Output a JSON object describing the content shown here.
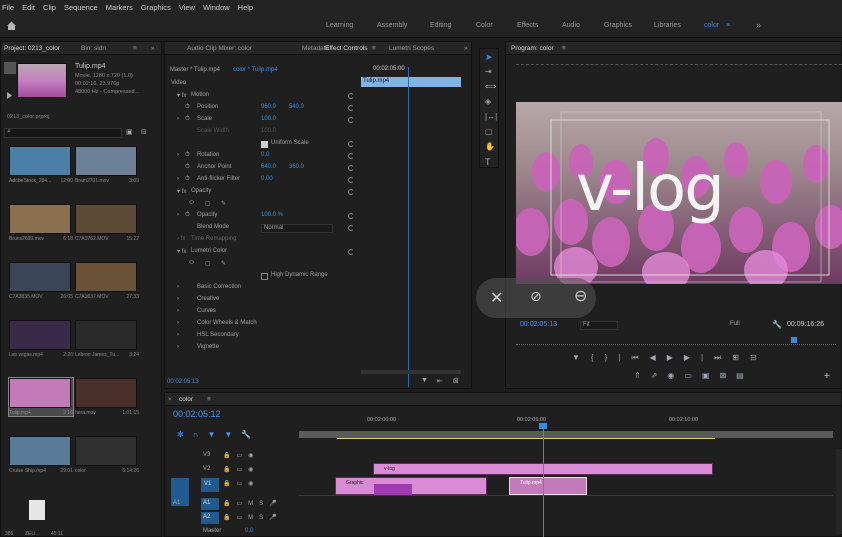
{
  "menu": [
    "File",
    "Edit",
    "Clip",
    "Sequence",
    "Markers",
    "Graphics",
    "View",
    "Window",
    "Help"
  ],
  "workspaces": [
    "Learning",
    "Assembly",
    "Editing",
    "Color",
    "Effects",
    "Audio",
    "Graphics",
    "Libraries",
    "color"
  ],
  "workspace_more": "»",
  "project": {
    "tabs": [
      "Project: 0213_color",
      "Bin: sidn"
    ],
    "preview_name": "Tulip.mp4",
    "preview_line1": "Movie, 1280 x 720 (1.0)",
    "preview_line2": "00:02:16, 23.976p",
    "preview_line3": "48000 Hz - Compressed...",
    "project_file": "0213_color.prproj",
    "items": [
      {
        "name": "AdobeStock_284...",
        "dur": "12:00",
        "color": "#4a7fa8"
      },
      {
        "name": "Bram2701.mov",
        "dur": "3:09",
        "color": "#6b7f96"
      },
      {
        "name": "Bruns2699.mov",
        "dur": "6:18",
        "color": "#8a7050"
      },
      {
        "name": "C7A3762.MOV",
        "dur": "15:22",
        "color": "#5c4a35"
      },
      {
        "name": "C7A3835.MOV",
        "dur": "26:05",
        "color": "#3a4658"
      },
      {
        "name": "C7A3637.MOV",
        "dur": "27:33",
        "color": "#6a5238"
      },
      {
        "name": "Las vegas.mp4",
        "dur": "2:20",
        "color": "#3a2a4a"
      },
      {
        "name": "Lebron James_Tu...",
        "dur": "3:24",
        "color": "#2a2a2a"
      },
      {
        "name": "Tulip.mp4",
        "dur": "2:16",
        "color": "#c27ab8"
      },
      {
        "name": "hera.mov",
        "dur": "1:01:15",
        "color": "#4a3028"
      },
      {
        "name": "Cruise Ship.mp4",
        "dur": "29:01",
        "color": "#5a7a98"
      },
      {
        "name": "color",
        "dur": "5:14:26",
        "color": "#303030"
      }
    ],
    "bottom_left": "386",
    "bottom_file": "ZELI...",
    "bottom_dur": "45:11"
  },
  "effects": {
    "tabs": [
      "Audio Clip Mixer: color",
      "Metadata",
      "Effect Controls",
      "Lumetri Scopes"
    ],
    "master": "Master * Tulip.mp4",
    "sequence": "color * Tulip.mp4",
    "timecode": "00:02:05:00",
    "clip_label": "Tulip.mp4",
    "section_video": "Video",
    "motion": "Motion",
    "position_label": "Position",
    "position_x": "960.0",
    "position_y": "540.0",
    "scale_label": "Scale",
    "scale_val": "100.0",
    "scale_width_label": "Scale Width",
    "scale_width_val": "100.0",
    "uniform": "Uniform Scale",
    "rotation_label": "Rotation",
    "rotation_val": "0.0",
    "anchor_label": "Anchor Point",
    "anchor_x": "640.0",
    "anchor_y": "360.0",
    "flicker_label": "Anti-flicker Filter",
    "flicker_val": "0.00",
    "opacity_section": "Opacity",
    "opacity_label": "Opacity",
    "opacity_val": "100.0 %",
    "blend_label": "Blend Mode",
    "blend_val": "Normal",
    "time_remap": "Time Remapping",
    "lumetri": "Lumetri Color",
    "hdr": "High Dynamic Range",
    "sections": [
      "Basic Correction",
      "Creative",
      "Curves",
      "Color Wheels & Match",
      "HSL Secondary",
      "Vignette"
    ],
    "footer_tc": "00:02:05:13"
  },
  "program": {
    "tab": "Program: color",
    "overlay_text": "v-log",
    "tc": "00:02:05:13",
    "fit": "Fit",
    "quality": "Full",
    "duration": "00:09:16:26"
  },
  "timeline": {
    "tab": "color",
    "tc": "00:02:05:12",
    "ruler": [
      "00:02:00:00",
      "00:02:05:00",
      "00:02:10:00"
    ],
    "tracks_video": [
      "V3",
      "V2",
      "V1"
    ],
    "tracks_audio": [
      "A1",
      "A2"
    ],
    "master": "Master",
    "master_val": "0.0",
    "clip_vlog": "v-log",
    "clip_graphic": "Graphic",
    "clip_tulip": "Tulip.mp4"
  },
  "colors": {
    "accent": "#3a8be0",
    "pink": "#d98bd6",
    "timecode": "#4a97f0"
  }
}
